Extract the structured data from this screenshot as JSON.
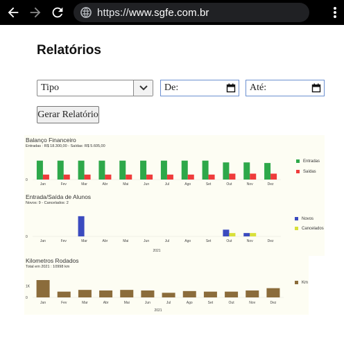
{
  "browser": {
    "url_scheme": "https://",
    "url_host": "www.sgfe.com.br",
    "icons": [
      "back-arrow-icon",
      "forward-arrow-icon",
      "reload-icon",
      "site-info-icon",
      "more-menu-icon"
    ]
  },
  "page": {
    "title": "Relatórios"
  },
  "form": {
    "tipo_selected": "Tipo",
    "de_label": "De:",
    "ate_label": "Até:",
    "submit_label": "Gerar Relatório"
  },
  "charts": {
    "financeiro": {
      "title": "Balanço Financeiro",
      "subtitle": "Entradas : R$ 18.300,00 - Saídas: R$ 5.605,00",
      "legend": [
        "Entradas",
        "Saídas"
      ]
    },
    "alunos": {
      "title": "Entrada/Saída de Alunos",
      "subtitle": "Novos: 9 - Cancelados: 2",
      "legend": [
        "Novos",
        "Cancelados"
      ],
      "xlabel": "2021"
    },
    "km": {
      "title": "Kilometros Rodados",
      "subtitle": "Total em 2021 : 10998 km",
      "legend": [
        "Km"
      ],
      "xlabel": "2021"
    }
  },
  "chart_data": [
    {
      "type": "bar",
      "title": "Balanço Financeiro",
      "categories": [
        "Jan",
        "Fev",
        "Mar",
        "Abr",
        "Mai",
        "Jun",
        "Jul",
        "Ago",
        "Set",
        "Out",
        "Nov",
        "Dez"
      ],
      "series": [
        {
          "name": "Entradas",
          "color": "#2ea84a",
          "values": [
            1600,
            1600,
            1600,
            1600,
            1600,
            1600,
            1600,
            1600,
            1600,
            1450,
            1450,
            1400
          ]
        },
        {
          "name": "Saídas",
          "color": "#ef3b3b",
          "values": [
            420,
            420,
            420,
            420,
            420,
            420,
            420,
            420,
            420,
            500,
            500,
            500
          ]
        }
      ],
      "yticks": [
        "0"
      ],
      "ylim": [
        0,
        1700
      ]
    },
    {
      "type": "bar",
      "title": "Entrada/Saída de Alunos",
      "categories": [
        "Jan",
        "Fev",
        "Mar",
        "Abr",
        "Mai",
        "Jun",
        "Jul",
        "Ago",
        "Set",
        "Out",
        "Nov",
        "Dez"
      ],
      "series": [
        {
          "name": "Novos",
          "color": "#3b4bbf",
          "values": [
            0,
            0,
            6,
            0,
            0,
            0,
            0,
            0,
            0,
            2,
            1,
            0
          ]
        },
        {
          "name": "Cancelados",
          "color": "#d8e03a",
          "values": [
            0,
            0,
            0,
            0,
            0,
            0,
            0,
            0,
            0,
            1,
            1,
            0
          ]
        }
      ],
      "xlabel": "2021",
      "yticks": [
        "0"
      ],
      "ylim": [
        0,
        7
      ]
    },
    {
      "type": "bar",
      "title": "Kilometros Rodados",
      "categories": [
        "Jan",
        "Fev",
        "Mar",
        "Abr",
        "Mai",
        "Jun",
        "Jul",
        "Ago",
        "Set",
        "Out",
        "Nov",
        "Dez"
      ],
      "series": [
        {
          "name": "Km",
          "color": "#8b6c3b",
          "values": [
            1500,
            500,
            650,
            600,
            650,
            600,
            400,
            550,
            500,
            500,
            600,
            800
          ]
        }
      ],
      "xlabel": "2021",
      "yticks": [
        "0",
        "1K"
      ],
      "ylim": [
        0,
        1800
      ]
    }
  ]
}
